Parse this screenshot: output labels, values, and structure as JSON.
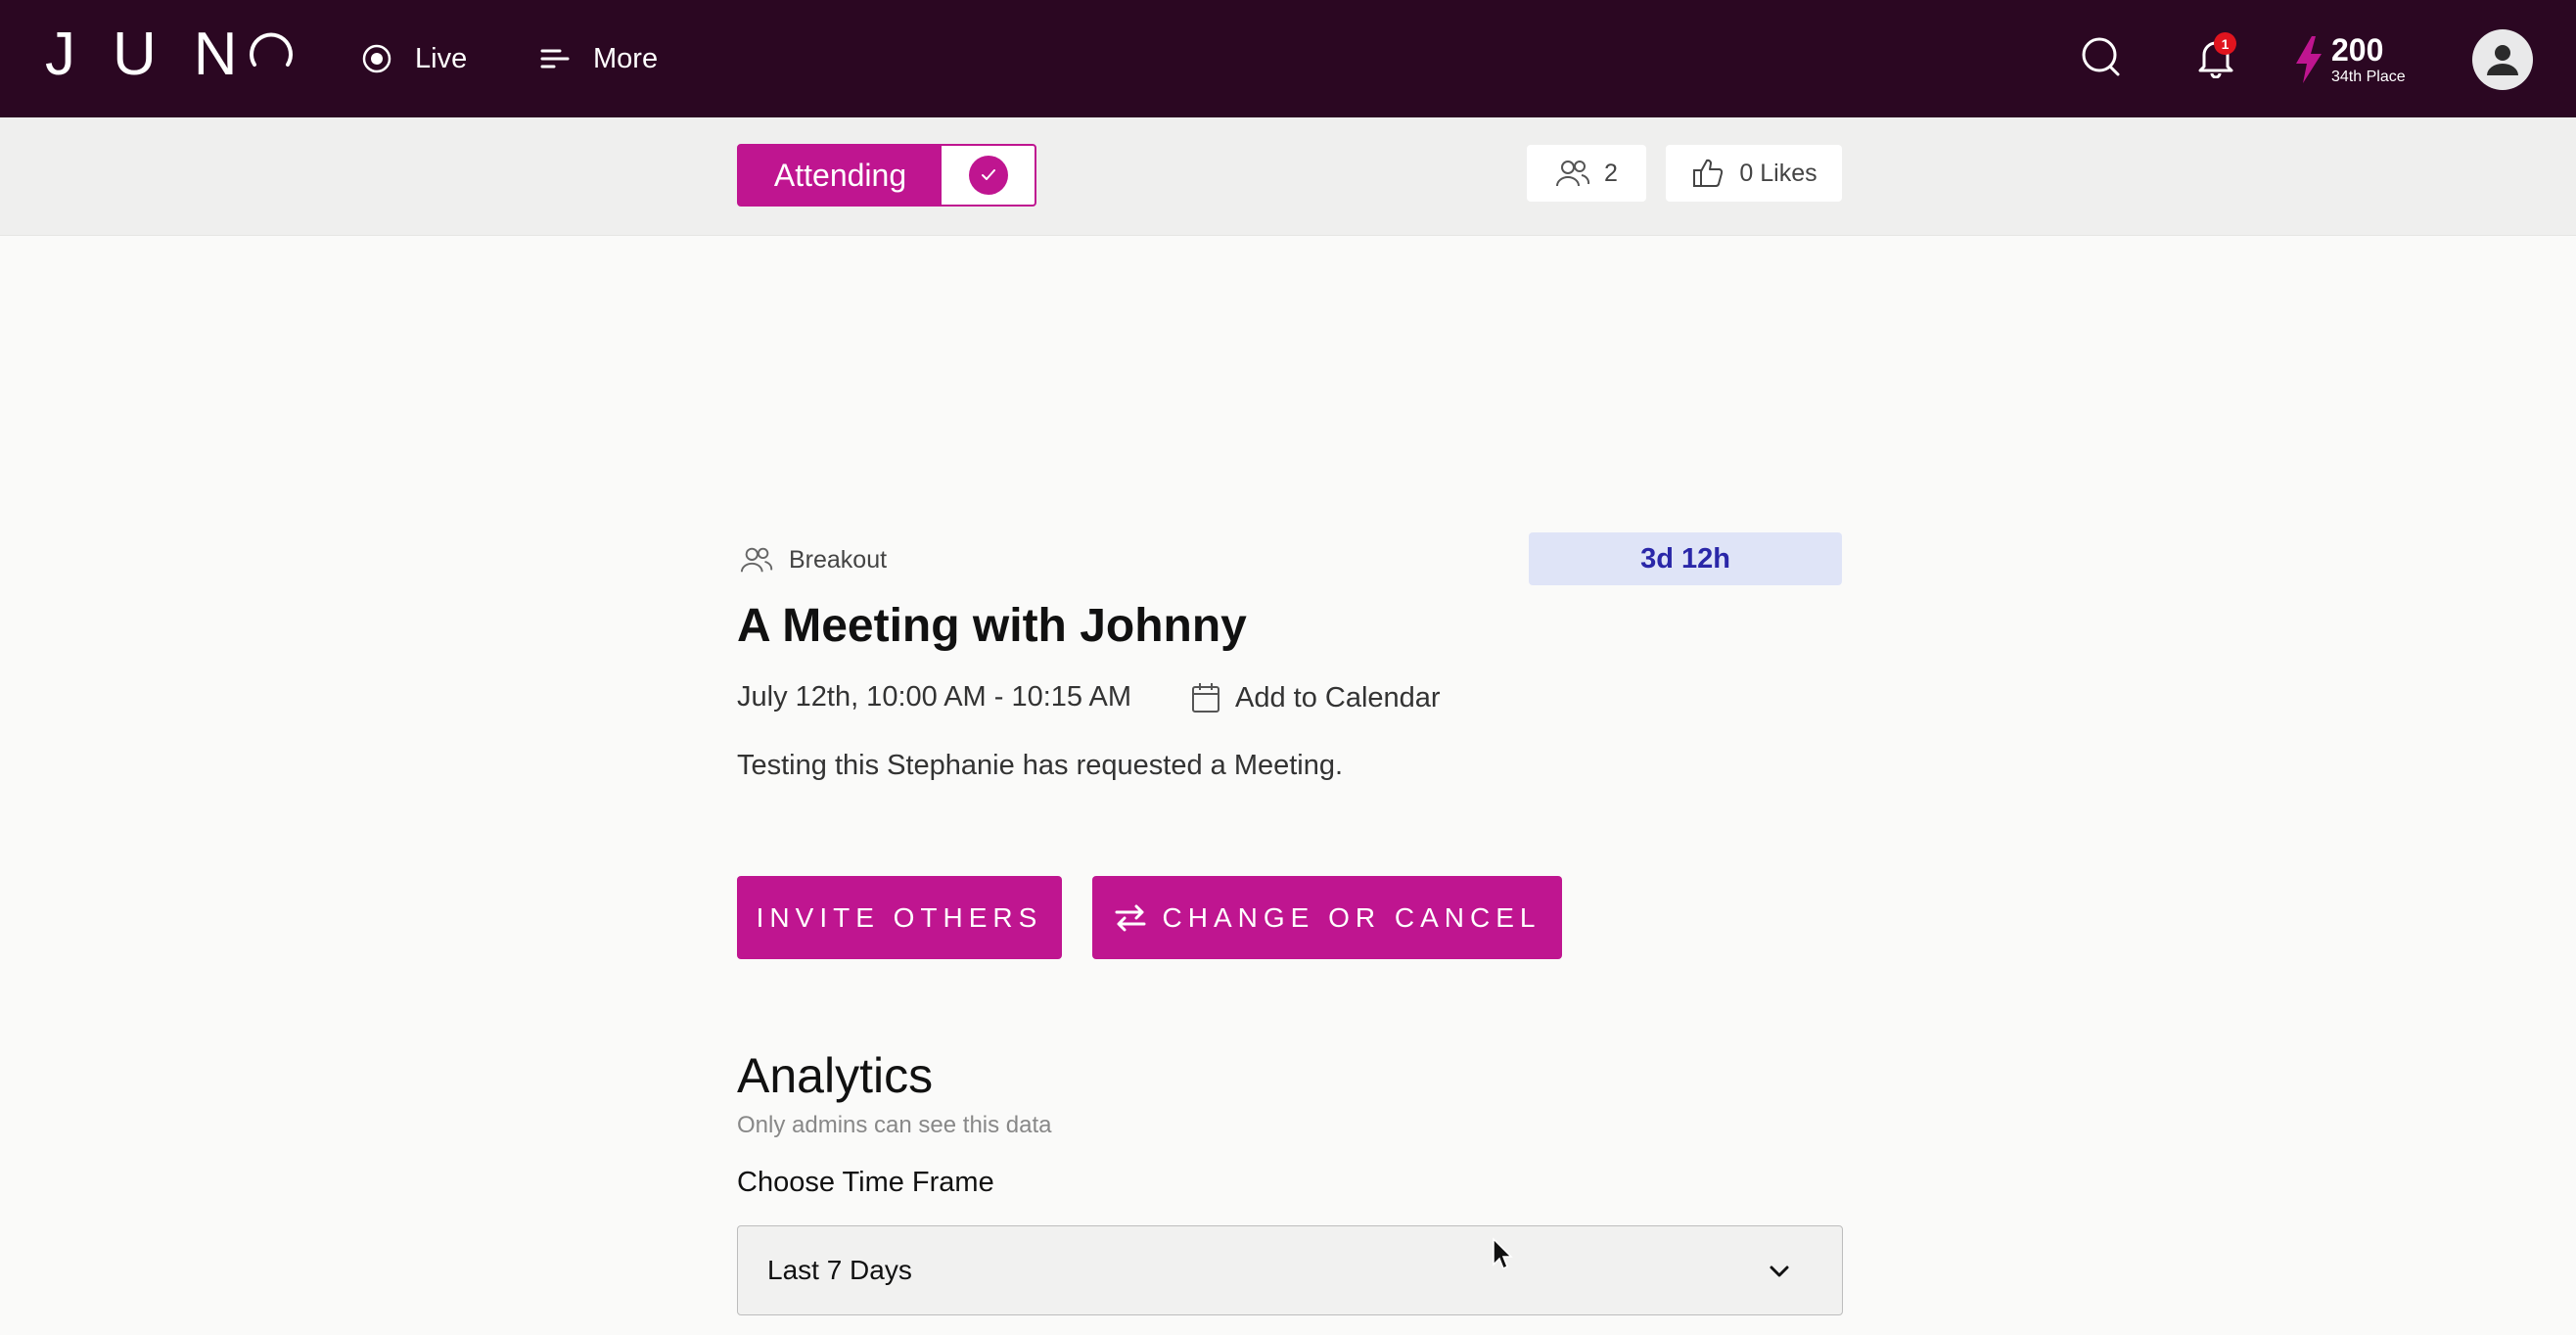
{
  "brand": {
    "logo_text": "JUN"
  },
  "nav": {
    "live_label": "Live",
    "more_label": "More",
    "notifications_count": "1",
    "points": "200",
    "place": "34th Place"
  },
  "subbar": {
    "attending_label": "Attending",
    "attendees_count": "2",
    "likes_label": "0 Likes"
  },
  "session": {
    "type": "Breakout",
    "countdown": "3d 12h",
    "title": "A Meeting with Johnny",
    "datetime": "July 12th, 10:00 AM - 10:15 AM",
    "add_to_calendar": "Add to Calendar",
    "description": "Testing this Stephanie has requested a Meeting."
  },
  "actions": {
    "invite_label": "INVITE OTHERS",
    "change_label": "CHANGE OR CANCEL"
  },
  "analytics": {
    "heading": "Analytics",
    "subtitle": "Only admins can see this data",
    "timeframe_label": "Choose Time Frame",
    "timeframe_value": "Last 7 Days"
  },
  "colors": {
    "topbar": "#2b0722",
    "accent": "#bf1590",
    "countdown_bg": "#dfe4f7",
    "countdown_text": "#2a27a8",
    "badge": "#e0141e"
  },
  "icons": [
    "live-radio-icon",
    "menu-icon",
    "search-icon",
    "bell-icon",
    "bolt-icon",
    "user-avatar-icon",
    "check-icon",
    "people-icon",
    "thumbs-up-icon",
    "calendar-icon",
    "swap-icon",
    "chevron-down-icon"
  ]
}
